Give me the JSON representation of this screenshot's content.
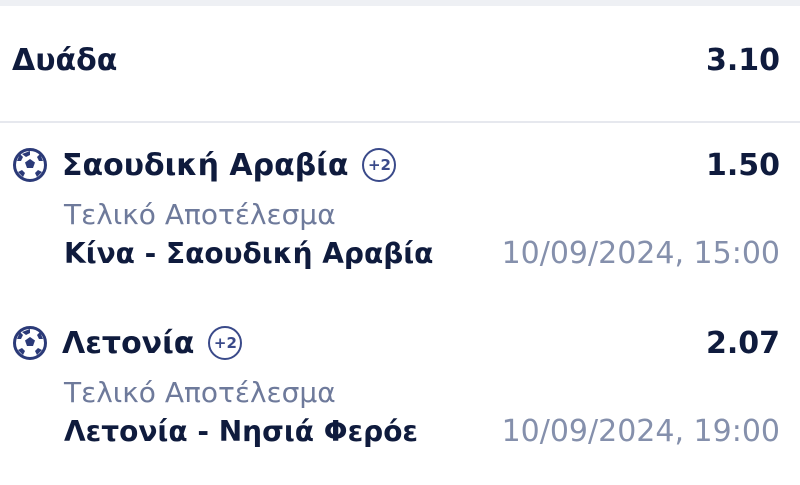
{
  "bet": {
    "type_label": "Δυάδα",
    "total_odds": "3.10"
  },
  "selections": [
    {
      "icon": "soccer-ball-icon",
      "team": "Σαουδική Αραβία",
      "extra_badge": "+2",
      "odds": "1.50",
      "market": "Τελικό Αποτέλεσμα",
      "match": "Κίνα - Σαουδική Αραβία",
      "datetime": "10/09/2024, 15:00"
    },
    {
      "icon": "soccer-ball-icon",
      "team": "Λετονία",
      "extra_badge": "+2",
      "odds": "2.07",
      "market": "Τελικό Αποτέλεσμα",
      "match": "Λετονία - Νησιά Φερόε",
      "datetime": "10/09/2024, 19:00"
    }
  ],
  "colors": {
    "primary_text": "#0f1b3d",
    "secondary_text": "#6e7a9b",
    "date_text": "#8590ac",
    "badge": "#3a4a8a",
    "divider": "#e6e8ee"
  }
}
